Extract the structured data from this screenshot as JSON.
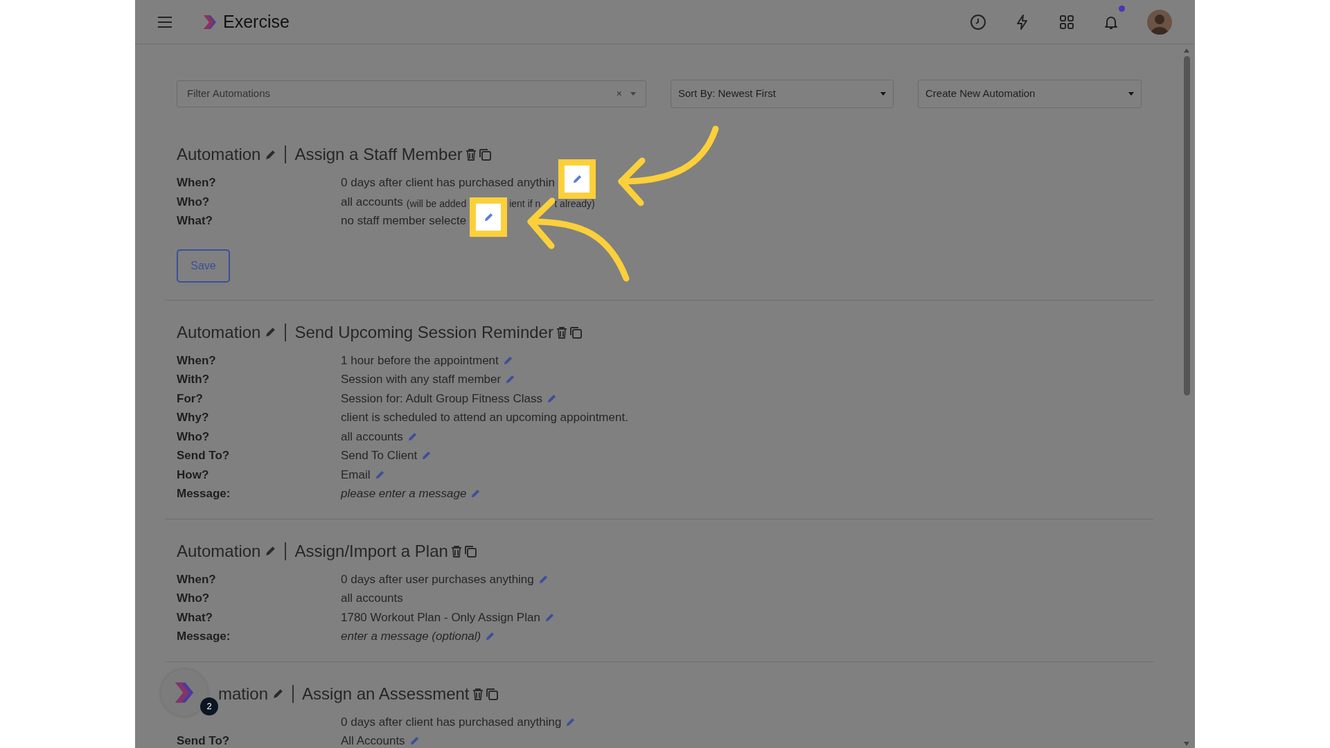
{
  "header": {
    "app_name": "Exercise",
    "notification_dot": true
  },
  "toolbar": {
    "filter": {
      "placeholder": "Filter Automations",
      "clear": "×"
    },
    "sort": {
      "value": "Sort By: Newest First"
    },
    "create": {
      "value": "Create New Automation"
    }
  },
  "automations": [
    {
      "prefix": "Automation",
      "title": "Assign a Staff Member",
      "save_button": "Save",
      "rows": [
        {
          "label": "When?",
          "value": "0 days after client has purchased anythin",
          "editable": true,
          "highlighted": true,
          "italic": false
        },
        {
          "label": "Who?",
          "value": "all accounts",
          "note_parts": [
            "(will be added",
            "ient if n",
            "t already)"
          ],
          "editable": false,
          "italic": false
        },
        {
          "label": "What?",
          "value": "no staff member selecte",
          "editable": true,
          "highlighted": true,
          "italic": false
        }
      ]
    },
    {
      "prefix": "Automation",
      "title": "Send Upcoming Session Reminder",
      "rows": [
        {
          "label": "When?",
          "value": "1 hour before the appointment",
          "editable": true,
          "highlighted": false,
          "italic": false
        },
        {
          "label": "With?",
          "value": "Session with any staff member",
          "editable": true,
          "highlighted": false,
          "italic": false
        },
        {
          "label": "For?",
          "value": "Session for: Adult Group Fitness Class",
          "editable": true,
          "highlighted": false,
          "italic": false
        },
        {
          "label": "Why?",
          "value": "client is scheduled to attend an upcoming appointment.",
          "editable": false,
          "italic": false
        },
        {
          "label": "Who?",
          "value": "all accounts",
          "editable": true,
          "highlighted": false,
          "italic": false
        },
        {
          "label": "Send To?",
          "value": "Send To Client",
          "editable": true,
          "highlighted": false,
          "italic": false
        },
        {
          "label": "How?",
          "value": "Email",
          "editable": true,
          "highlighted": false,
          "italic": false
        },
        {
          "label": "Message:",
          "value": "please enter a message",
          "editable": true,
          "highlighted": false,
          "italic": true
        }
      ]
    },
    {
      "prefix": "Automation",
      "title": "Assign/Import a Plan",
      "rows": [
        {
          "label": "When?",
          "value": "0 days after user purchases anything",
          "editable": true,
          "highlighted": false,
          "italic": false
        },
        {
          "label": "Who?",
          "value": "all accounts",
          "editable": false,
          "italic": false
        },
        {
          "label": "What?",
          "value": "1780 Workout Plan - Only Assign Plan",
          "editable": true,
          "highlighted": false,
          "italic": false
        },
        {
          "label": "Message:",
          "value": "enter a message (optional)",
          "editable": true,
          "highlighted": false,
          "italic": true
        }
      ]
    },
    {
      "prefix": "mation",
      "title": "Assign an Assessment",
      "rows": [
        {
          "value": "0 days after client has purchased anything",
          "editable": true,
          "highlighted": false,
          "italic": false
        },
        {
          "label": "Send To?",
          "value": "All Accounts",
          "editable": true,
          "highlighted": false,
          "italic": false
        }
      ]
    }
  ],
  "chat_widget": {
    "badge": "2"
  }
}
